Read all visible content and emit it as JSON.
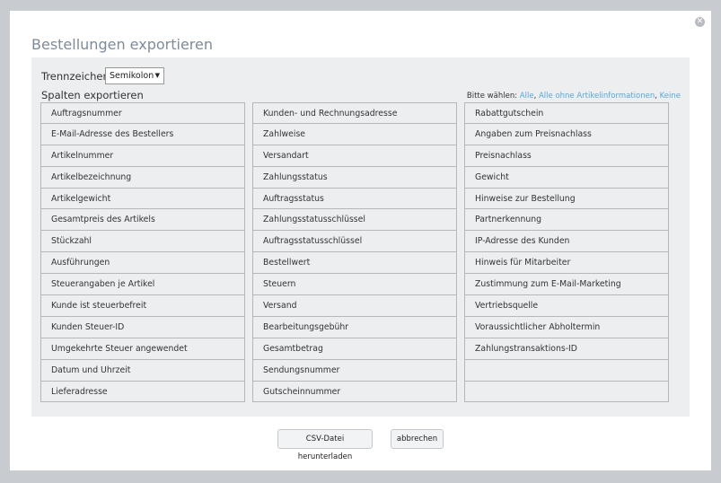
{
  "dialog": {
    "title": "Bestellungen exportieren",
    "close_icon": "close-icon"
  },
  "separator": {
    "label": "Trennzeichen",
    "selected": "Semikolon"
  },
  "columns": {
    "label": "Spalten exportieren",
    "choose_label": "Bitte wählen:",
    "choose_all": "Alle",
    "choose_no_article": "Alle ohne Artikelinformationen",
    "choose_none": "Keine",
    "col1": [
      "Auftragsnummer",
      "E-Mail-Adresse des Bestellers",
      "Artikelnummer",
      "Artikelbezeichnung",
      "Artikelgewicht",
      "Gesamtpreis des Artikels",
      "Stückzahl",
      "Ausführungen",
      "Steuerangaben je Artikel",
      "Kunde ist steuerbefreit",
      "Kunden Steuer-ID",
      "Umgekehrte Steuer angewendet",
      "Datum und Uhrzeit",
      "Lieferadresse"
    ],
    "col2": [
      "Kunden- und Rechnungsadresse",
      "Zahlweise",
      "Versandart",
      "Zahlungsstatus",
      "Auftragsstatus",
      "Zahlungsstatusschlüssel",
      "Auftragsstatusschlüssel",
      "Bestellwert",
      "Steuern",
      "Versand",
      "Bearbeitungsgebühr",
      "Gesamtbetrag",
      "Sendungsnummer",
      "Gutscheinnummer"
    ],
    "col3": [
      "Rabattgutschein",
      "Angaben zum Preisnachlass",
      "Preisnachlass",
      "Gewicht",
      "Hinweise zur Bestellung",
      "Partnerkennung",
      "IP-Adresse des Kunden",
      "Hinweis für Mitarbeiter",
      "Zustimmung zum E-Mail-Marketing",
      "Vertriebsquelle",
      "Voraussichtlicher Abholtermin",
      "Zahlungstransaktions-ID",
      "",
      ""
    ]
  },
  "buttons": {
    "download": "CSV-Datei herunterladen",
    "cancel": "abbrechen"
  }
}
